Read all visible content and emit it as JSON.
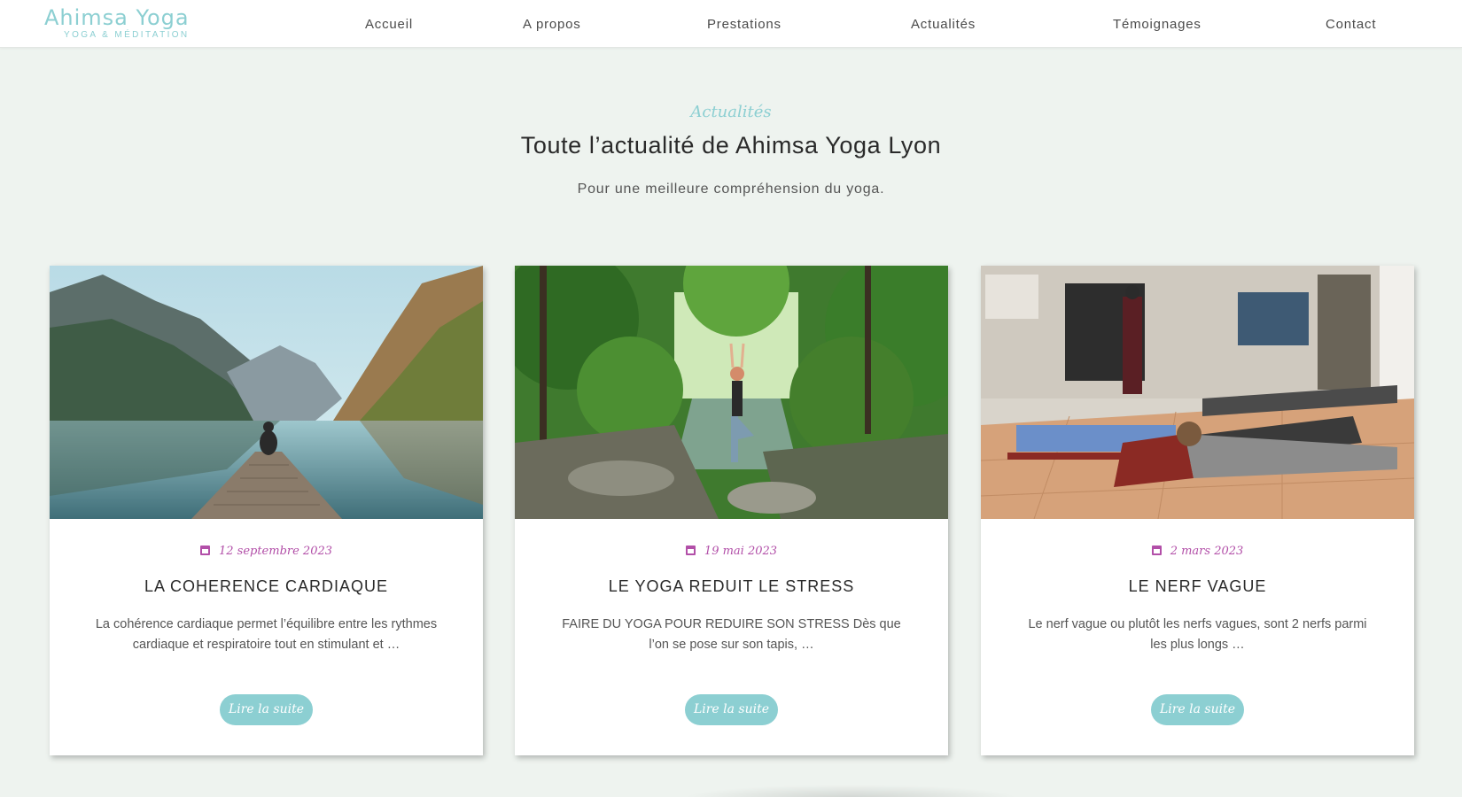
{
  "brand": {
    "title": "Ahimsa Yoga",
    "subtitle": "YOGA & MÉDITATION",
    "color": "#8ccfd2"
  },
  "nav": {
    "items": [
      {
        "label": "Accueil"
      },
      {
        "label": "A propos"
      },
      {
        "label": "Prestations"
      },
      {
        "label": "Actualités"
      },
      {
        "label": "Témoignages"
      },
      {
        "label": "Contact"
      }
    ]
  },
  "section": {
    "kicker": "Actualités",
    "title": "Toute l’actualité de Ahimsa Yoga Lyon",
    "subtitle": "Pour une meilleure compréhension du yoga."
  },
  "articles": [
    {
      "date": "12 septembre 2023",
      "title": "LA COHERENCE CARDIAQUE",
      "excerpt": "La cohérence cardiaque permet l’équilibre entre les rythmes cardiaque et respiratoire tout en stimulant et …",
      "button": "Lire la suite",
      "image": "lake-mountains-meditation-photo"
    },
    {
      "date": "19 mai 2023",
      "title": "LE YOGA REDUIT LE STRESS",
      "excerpt": "FAIRE DU YOGA POUR REDUIRE SON STRESS Dès que l’on se pose sur son tapis, …",
      "button": "Lire la suite",
      "image": "forest-tree-pose-photo"
    },
    {
      "date": "2 mars 2023",
      "title": "LE NERF VAGUE",
      "excerpt": "Le nerf vague ou plutôt les nerfs vagues, sont 2 nerfs parmi les plus longs …",
      "button": "Lire la suite",
      "image": "yoga-class-studio-photo"
    }
  ],
  "colors": {
    "accent": "#8ccfd2",
    "date": "#b24fa8",
    "background": "#eef3ef"
  }
}
